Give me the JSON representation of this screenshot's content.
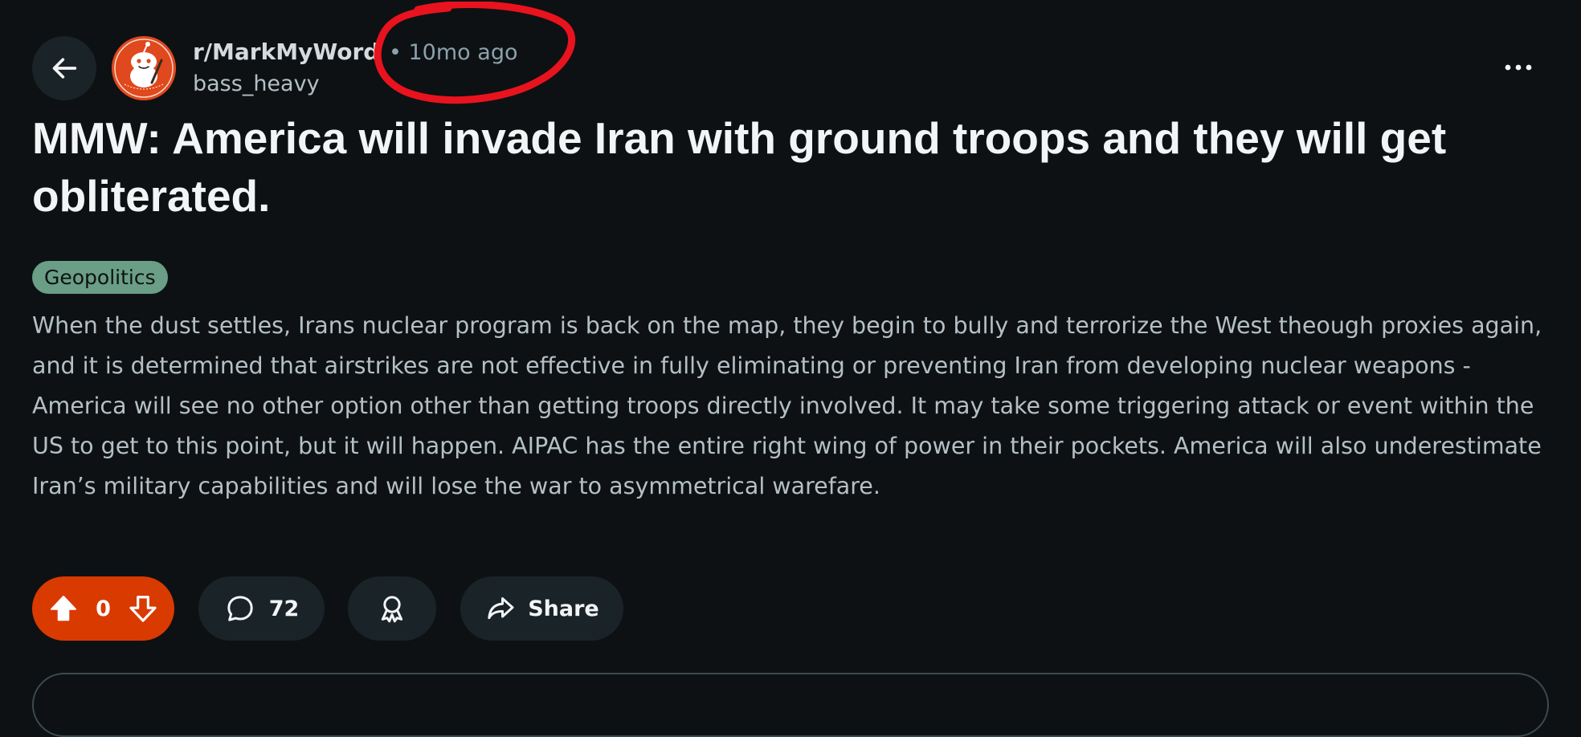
{
  "post": {
    "subreddit": "r/MarkMyWords",
    "timestamp": "• 10mo ago",
    "author": "bass_heavy",
    "title": "MMW: America will invade Iran with ground troops and they will get obliterated.",
    "flair": "Geopolitics",
    "body": "When the dust settles, Irans nuclear program is back on the map, they begin to bully and terrorize the West theough proxies again, and it is determined that airstrikes are not effective in fully eliminating or preventing Iran from developing nuclear weapons - America will see no other option other than getting troops directly involved. It may take some triggering attack or event within the US to get to this point, but it will happen. AIPAC has the entire right wing of power in their pockets. America will also underestimate Iran’s military capabilities and will lose the war to asymmetrical warefare."
  },
  "actions": {
    "score": "0",
    "comments": "72",
    "share_label": "Share"
  },
  "icons": {
    "back": "arrow-left-icon",
    "more": "more-dots-icon",
    "upvote": "upvote-arrow-icon",
    "downvote": "downvote-arrow-icon",
    "comment": "comment-bubble-icon",
    "award": "award-ribbon-icon",
    "share": "share-arrow-icon"
  },
  "colors": {
    "background": "#0e1113",
    "vote_pill": "#d93a00",
    "button_bg": "#1a2327",
    "flair_bg": "#6a9e86",
    "annotation": "#e8131e"
  }
}
